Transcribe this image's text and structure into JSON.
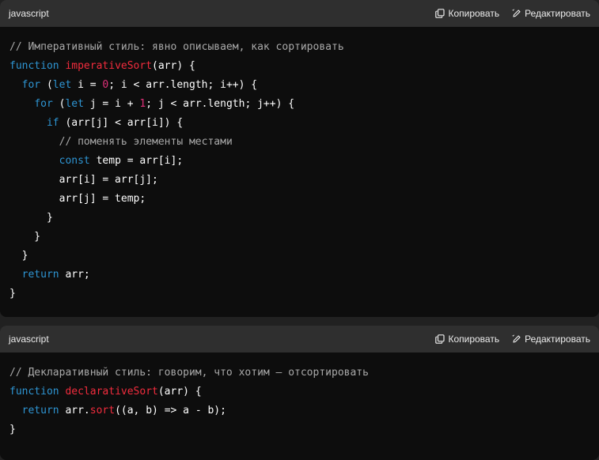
{
  "blocks": [
    {
      "language": "javascript",
      "copy_label": "Копировать",
      "edit_label": "Редактировать",
      "lines": [
        [
          {
            "t": "cm",
            "v": "// Императивный стиль: явно описываем, как сортировать"
          }
        ],
        [
          {
            "t": "kw",
            "v": "function"
          },
          {
            "t": "p",
            "v": " "
          },
          {
            "t": "fn",
            "v": "imperativeSort"
          },
          {
            "t": "p",
            "v": "(arr) {"
          }
        ],
        [
          {
            "t": "p",
            "v": "  "
          },
          {
            "t": "kw",
            "v": "for"
          },
          {
            "t": "p",
            "v": " ("
          },
          {
            "t": "kw",
            "v": "let"
          },
          {
            "t": "p",
            "v": " i = "
          },
          {
            "t": "num",
            "v": "0"
          },
          {
            "t": "p",
            "v": "; i < arr.length; i++) {"
          }
        ],
        [
          {
            "t": "p",
            "v": "    "
          },
          {
            "t": "kw",
            "v": "for"
          },
          {
            "t": "p",
            "v": " ("
          },
          {
            "t": "kw",
            "v": "let"
          },
          {
            "t": "p",
            "v": " j = i + "
          },
          {
            "t": "num",
            "v": "1"
          },
          {
            "t": "p",
            "v": "; j < arr.length; j++) {"
          }
        ],
        [
          {
            "t": "p",
            "v": "      "
          },
          {
            "t": "kw",
            "v": "if"
          },
          {
            "t": "p",
            "v": " (arr[j] < arr[i]) {"
          }
        ],
        [
          {
            "t": "p",
            "v": "        "
          },
          {
            "t": "cm",
            "v": "// поменять элементы местами"
          }
        ],
        [
          {
            "t": "p",
            "v": "        "
          },
          {
            "t": "kw",
            "v": "const"
          },
          {
            "t": "p",
            "v": " temp = arr[i];"
          }
        ],
        [
          {
            "t": "p",
            "v": "        arr[i] = arr[j];"
          }
        ],
        [
          {
            "t": "p",
            "v": "        arr[j] = temp;"
          }
        ],
        [
          {
            "t": "p",
            "v": "      }"
          }
        ],
        [
          {
            "t": "p",
            "v": "    }"
          }
        ],
        [
          {
            "t": "p",
            "v": "  }"
          }
        ],
        [
          {
            "t": "p",
            "v": "  "
          },
          {
            "t": "kw",
            "v": "return"
          },
          {
            "t": "p",
            "v": " arr;"
          }
        ],
        [
          {
            "t": "p",
            "v": "}"
          }
        ]
      ]
    },
    {
      "language": "javascript",
      "copy_label": "Копировать",
      "edit_label": "Редактировать",
      "lines": [
        [
          {
            "t": "cm",
            "v": "// Декларативный стиль: говорим, что хотим — отсортировать"
          }
        ],
        [
          {
            "t": "kw",
            "v": "function"
          },
          {
            "t": "p",
            "v": " "
          },
          {
            "t": "fn",
            "v": "declarativeSort"
          },
          {
            "t": "p",
            "v": "(arr) {"
          }
        ],
        [
          {
            "t": "p",
            "v": "  "
          },
          {
            "t": "kw",
            "v": "return"
          },
          {
            "t": "p",
            "v": " arr."
          },
          {
            "t": "mth",
            "v": "sort"
          },
          {
            "t": "p",
            "v": "((a, b) => a - b);"
          }
        ],
        [
          {
            "t": "p",
            "v": "}"
          }
        ]
      ]
    }
  ],
  "colors": {
    "keyword": "#2e95d3",
    "function_name": "#f22c3d",
    "number": "#df3079",
    "comment": "#a9a9a9",
    "plain": "#ffffff",
    "code_bg": "#0d0d0d",
    "header_bg": "#2f2f2f"
  },
  "icons": {
    "copy": "copy-icon",
    "edit": "edit-icon"
  }
}
